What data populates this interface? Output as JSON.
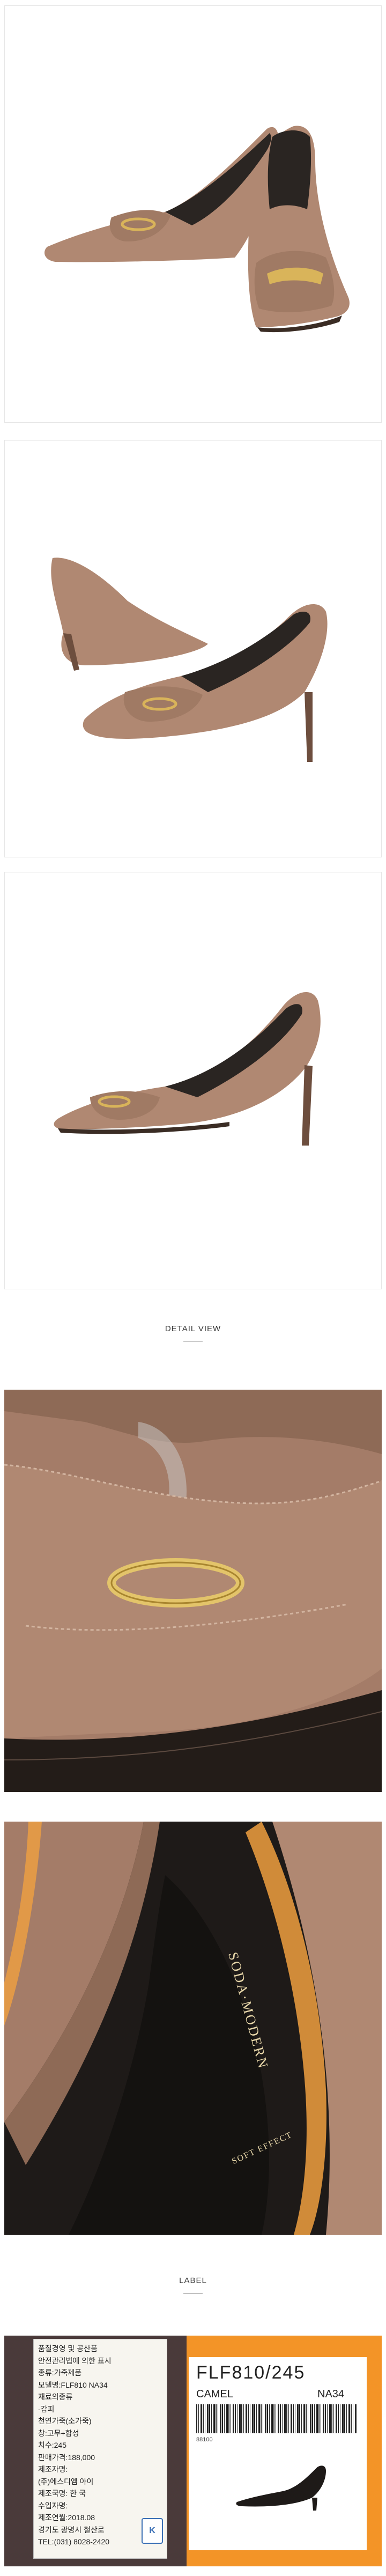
{
  "sections": {
    "detail_view_title": "DETAIL VIEW",
    "label_title": "LABEL"
  },
  "insole_text": {
    "brand": "SODA·MODERN",
    "soft_effect": "SOFT EFFECT"
  },
  "label_card": {
    "lines": [
      "품질경영 및 공산품",
      "안전관리법에 의한 표시",
      "종류:가죽제품",
      "모델명:FLF810 NA34",
      "재료의종류",
      "-갑피",
      "천연가죽(소가죽)",
      "창:고무+합성",
      "치수:245",
      "판매가격:188,000",
      "제조자명:",
      "(주)에스디엠 아이",
      "제조국명: 한 국",
      "수입자명:",
      "제조연월:2018.08",
      "경기도 광명시 철산로",
      "TEL:(031) 8028-2420"
    ]
  },
  "sticker": {
    "code": "FLF810/245",
    "color": "CAMEL",
    "model": "NA34",
    "small_number": "88100"
  },
  "colors": {
    "suede": "#b08872",
    "suede_dark": "#8e6a56",
    "gold": "#d9b45a",
    "sticker_orange": "#f39427"
  }
}
